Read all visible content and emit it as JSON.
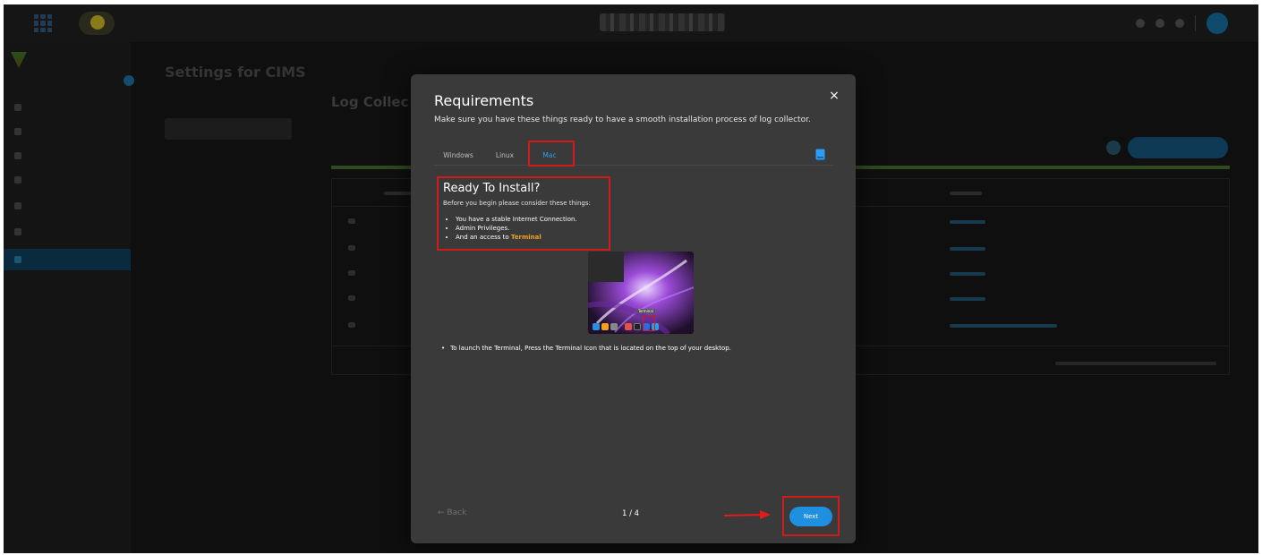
{
  "modal": {
    "title": "Requirements",
    "subtitle": "Make sure you have these things ready to have a smooth installation process of log collector.",
    "close_glyph": "×",
    "tabs": [
      {
        "label": "Windows",
        "active": false
      },
      {
        "label": "Linux",
        "active": false
      },
      {
        "label": "Mac",
        "active": true
      }
    ],
    "section": {
      "heading": "Ready To Install?",
      "intro": "Before you begin please consider these things:",
      "items": [
        "You have a stable Internet Connection.",
        "Admin Privileges.",
        "And an access to "
      ],
      "terminal_word": "Terminal"
    },
    "dock_tooltip": "Terminal",
    "instruction": "To launch the Terminal, Press the Terminal Icon that is located on the top of your desktop.",
    "footer": {
      "back_label": "← Back",
      "pager": "1 / 4",
      "next_label": "Next"
    }
  },
  "background": {
    "page_title": "Settings for CIMS",
    "section_title": "Log Collec"
  },
  "icons": {
    "close": "close-icon",
    "book": "book-icon",
    "arrow": "arrow-right-icon",
    "apps": "apps-grid-icon"
  },
  "colors": {
    "accent": "#1f8fe0",
    "annotation": "#d11a1a",
    "terminal_highlight": "#f2a01c",
    "modal_bg": "#3a3a3a"
  }
}
